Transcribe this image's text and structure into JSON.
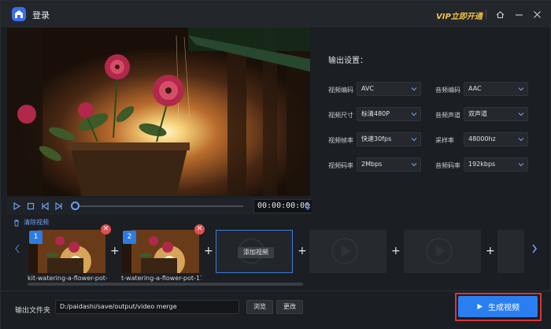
{
  "window": {
    "login_label": "登录",
    "vip_label": "VIP立即开通"
  },
  "player": {
    "timecode": "00:00:00:00"
  },
  "settings": {
    "title": "输出设置：",
    "fields": [
      {
        "label": "视频编码",
        "value": "AVC"
      },
      {
        "label": "音频编码",
        "value": "AAC"
      },
      {
        "label": "视频尺寸",
        "value": "标清480P"
      },
      {
        "label": "音频声道",
        "value": "双声道"
      },
      {
        "label": "视频帧率",
        "value": "快速30fps"
      },
      {
        "label": "采样率",
        "value": "48000hz"
      },
      {
        "label": "视频码率",
        "value": "2Mbps"
      },
      {
        "label": "音频码率",
        "value": "192kbps"
      }
    ]
  },
  "clips": {
    "clear_label": "清除视频",
    "items": [
      {
        "number": "1",
        "name": "kit-watering-a-flower-pot-1"
      },
      {
        "number": "2",
        "name": "t-watering-a-flower-pot-17€"
      }
    ],
    "add_label": "添加视频"
  },
  "output": {
    "label": "输出文件夹",
    "path": "D:/paidashi/save/output/video merge",
    "browse_label": "浏览",
    "change_label": "更改",
    "generate_label": "生成视频"
  },
  "colors": {
    "accent": "#2a7ff0",
    "vip": "#f2c04a",
    "highlight_frame": "#d8353a",
    "delete": "#e05050"
  }
}
